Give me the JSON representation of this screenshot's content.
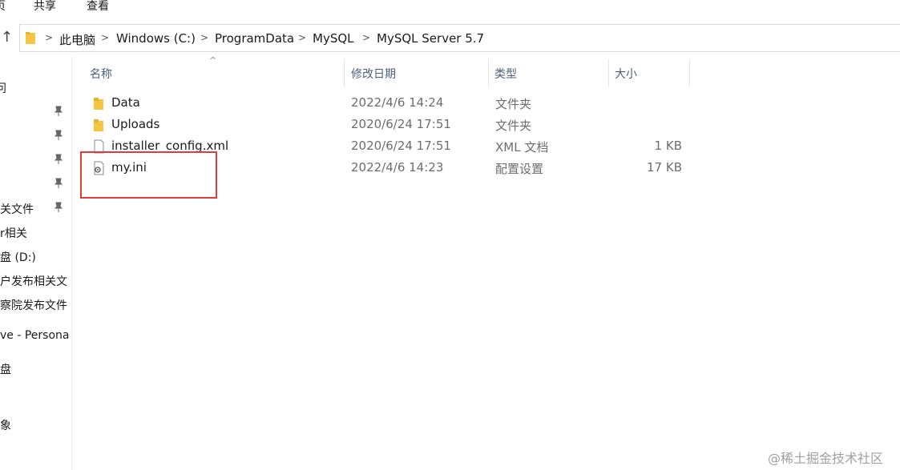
{
  "ribbon": {
    "tabs": [
      "页",
      "共享",
      "查看"
    ]
  },
  "breadcrumb": [
    "此电脑",
    "Windows (C:)",
    "ProgramData",
    "MySQL",
    "MySQL Server 5.7"
  ],
  "nav": {
    "items": [
      "问",
      "关文件",
      "r相关",
      "盘 (D:)",
      "户发布相关文",
      "察院发布文件",
      "ve - Persona",
      "盘",
      "象"
    ]
  },
  "columns": {
    "name": "名称",
    "date": "修改日期",
    "type": "类型",
    "size": "大小"
  },
  "files": [
    {
      "name": "Data",
      "date": "2022/4/6 14:24",
      "type": "文件夹",
      "size": "",
      "icon": "folder-icon"
    },
    {
      "name": "Uploads",
      "date": "2020/6/24 17:51",
      "type": "文件夹",
      "size": "",
      "icon": "folder-icon"
    },
    {
      "name": "installer_config.xml",
      "date": "2020/6/24 17:51",
      "type": "XML 文档",
      "size": "1 KB",
      "icon": "document-icon"
    },
    {
      "name": "my.ini",
      "date": "2022/4/6 14:23",
      "type": "配置设置",
      "size": "17 KB",
      "icon": "settings-file-icon"
    }
  ],
  "watermark": "@稀土掘金技术社区",
  "colors": {
    "highlight": "#e03c3c",
    "folder": "#f5c441",
    "header_text": "#4c607a"
  }
}
